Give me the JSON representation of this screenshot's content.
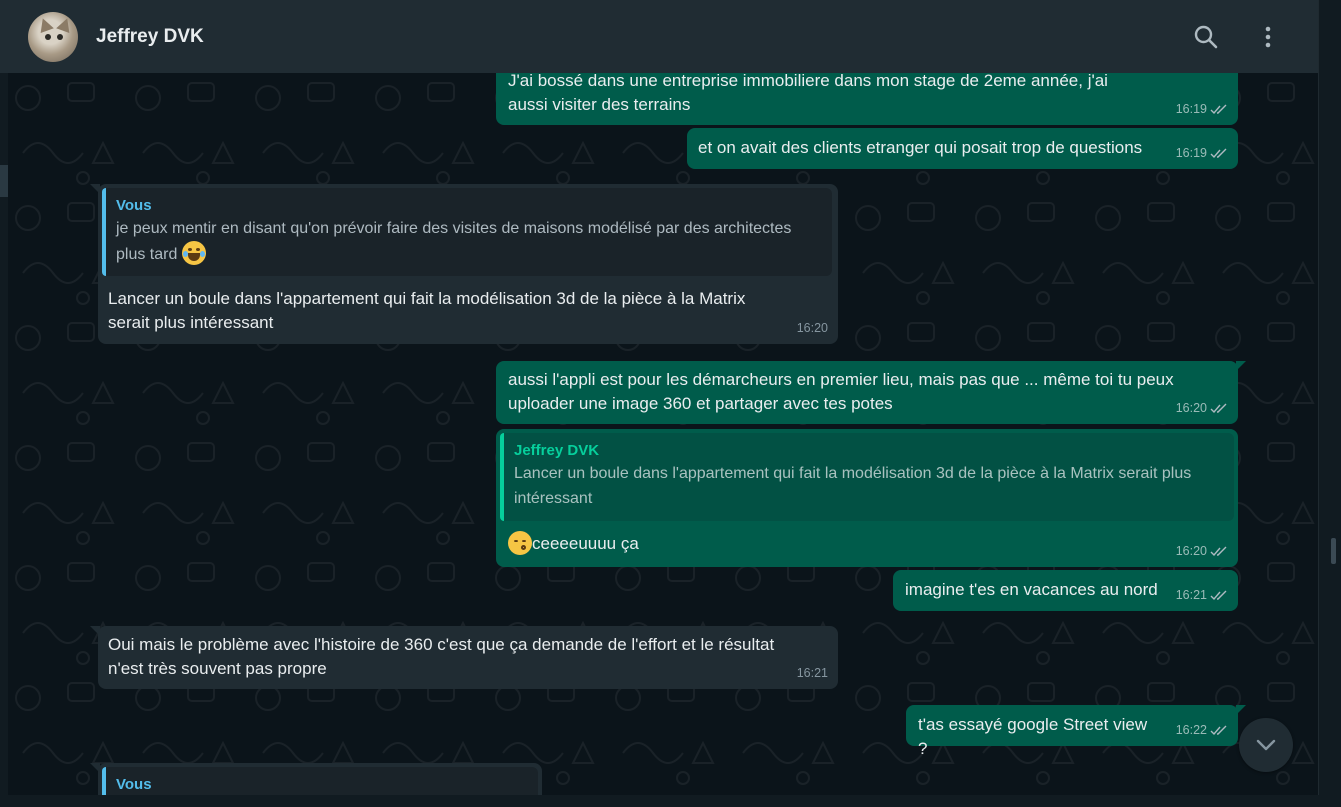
{
  "header": {
    "contact_name": "Jeffrey DVK",
    "avatar_icon": "cat-avatar-icon",
    "search_icon": "search-icon",
    "menu_icon": "kebab-menu-icon"
  },
  "colors": {
    "outgoing_bubble": "#005c4b",
    "incoming_bubble": "#202c33",
    "background": "#0b141a",
    "quote_in_accent": "#53bdeb",
    "quote_out_accent": "#06cf9c"
  },
  "messages": [
    {
      "direction": "out",
      "text": "J'ai bossé dans une entreprise immobiliere dans mon stage de 2eme année, j'ai aussi visiter des terrains",
      "time": "16:19"
    },
    {
      "direction": "out",
      "text": "et on avait des clients etranger qui posait trop de questions",
      "time": "16:19"
    },
    {
      "direction": "in",
      "quote_author": "Vous",
      "quote_text": "je peux mentir en disant qu'on prévoir faire des visites de maisons modélisé par des architectes plus tard",
      "quote_emoji": "tears-of-joy-emoji",
      "text": "Lancer un boule dans l'appartement qui fait la modélisation 3d de la pièce à la Matrix serait plus intéressant",
      "time": "16:20"
    },
    {
      "direction": "out",
      "text": "aussi l'appli est pour les démarcheurs en premier lieu, mais pas que ... même toi tu peux uploader une image 360 et partager avec tes potes",
      "time": "16:20"
    },
    {
      "direction": "out",
      "quote_author": "Jeffrey DVK",
      "quote_text": "Lancer un boule dans l'appartement qui fait la modélisation 3d de la pièce à la Matrix serait plus intéressant",
      "emoji": "kissing-face-emoji",
      "text": "ceeeeuuuu ça",
      "time": "16:20"
    },
    {
      "direction": "out",
      "text": "imagine t'es en vacances au nord",
      "time": "16:21"
    },
    {
      "direction": "in",
      "text": "Oui mais le problème avec l'histoire de 360 c'est que ça demande de l'effort et le résultat n'est très souvent pas propre",
      "time": "16:21"
    },
    {
      "direction": "out",
      "text": "t'as essayé google Street view ?",
      "time": "16:22"
    },
    {
      "direction": "in",
      "quote_author": "Vous",
      "partial": true
    }
  ],
  "scroll_down_icon": "chevron-down-icon"
}
